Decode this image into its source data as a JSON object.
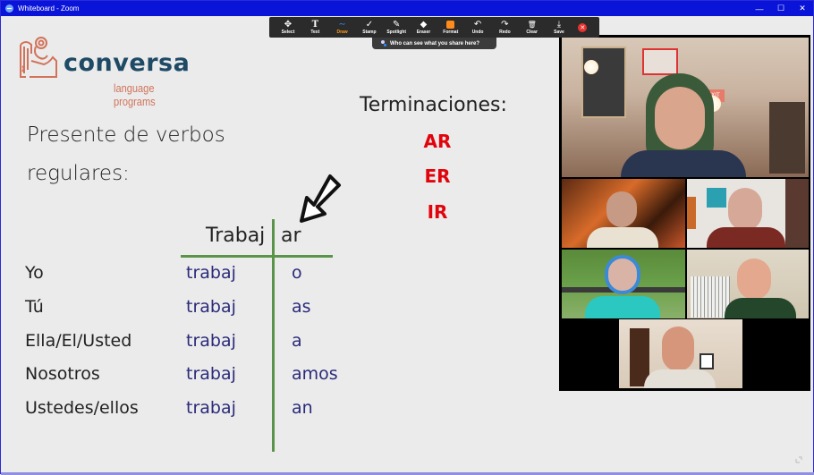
{
  "window": {
    "title": "Whiteboard - Zoom",
    "controls": {
      "minimize": "—",
      "maximize": "☐",
      "close": "✕"
    }
  },
  "toolbar": {
    "tools": [
      {
        "id": "select",
        "label": "Select",
        "icon": "✥"
      },
      {
        "id": "text",
        "label": "Text",
        "icon": "T"
      },
      {
        "id": "draw",
        "label": "Draw",
        "icon": "∼",
        "active": true
      },
      {
        "id": "stamp",
        "label": "Stamp",
        "icon": "✓"
      },
      {
        "id": "spotlight",
        "label": "Spotlight",
        "icon": "✎"
      },
      {
        "id": "eraser",
        "label": "Eraser",
        "icon": "◆"
      },
      {
        "id": "format",
        "label": "Format",
        "icon": "format-swatch"
      },
      {
        "id": "undo",
        "label": "Undo",
        "icon": "↶"
      },
      {
        "id": "redo",
        "label": "Redo",
        "icon": "↷"
      },
      {
        "id": "clear",
        "label": "Clear",
        "icon": "🗑"
      },
      {
        "id": "save",
        "label": "Save",
        "icon": "⤓"
      }
    ],
    "close_icon": "✕",
    "format_color": "#ff8c1a",
    "share_notice": "Who can see what you share here?"
  },
  "whiteboard": {
    "logo": {
      "name": "conversa",
      "tagline": "language programs"
    },
    "heading_lines": [
      "Presente de verbos",
      "regulares:"
    ],
    "endings_title": "Terminaciones:",
    "endings": [
      "AR",
      "ER",
      "IR"
    ],
    "verb": {
      "stem": "Trabaj",
      "ending": "ar"
    },
    "conjugation": [
      {
        "pronoun": "Yo",
        "stem": "trabaj",
        "ending": "o"
      },
      {
        "pronoun": "Tú",
        "stem": "trabaj",
        "ending": "as"
      },
      {
        "pronoun": "Ella/El/Usted",
        "stem": "trabaj",
        "ending": "a"
      },
      {
        "pronoun": "Nosotros",
        "stem": "trabaj",
        "ending": "amos"
      },
      {
        "pronoun": "Ustedes/ellos",
        "stem": "trabaj",
        "ending": "an"
      }
    ],
    "colors": {
      "endings_red": "#e1040c",
      "table_line_green": "#5a9448",
      "conjugation_blue": "#2a2a7a",
      "logo_blue": "#1e4a66",
      "logo_orange": "#d1735a"
    }
  },
  "gallery": {
    "participants": [
      {
        "tile": "speaker"
      },
      {
        "tile": "participant-2"
      },
      {
        "tile": "participant-3"
      },
      {
        "tile": "participant-4"
      },
      {
        "tile": "participant-5"
      },
      {
        "tile": "participant-6"
      }
    ]
  }
}
